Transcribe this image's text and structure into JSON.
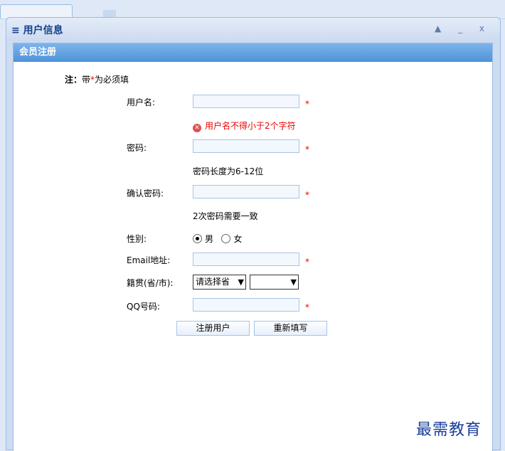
{
  "window": {
    "title": "用户信息",
    "tools": "▲ _ x"
  },
  "panel": {
    "title": "会员注册"
  },
  "note": {
    "prefix": "注：",
    "mid": "带",
    "star": "*",
    "suffix": "为必须填"
  },
  "form": {
    "username": {
      "label": "用户名:",
      "value": "",
      "required": "*",
      "error": "用户名不得小于2个字符"
    },
    "password": {
      "label": "密码:",
      "value": "",
      "required": "*",
      "hint": "密码长度为6-12位"
    },
    "confirm": {
      "label": "确认密码:",
      "value": "",
      "required": "*",
      "hint": "2次密码需要一致"
    },
    "gender": {
      "label": "性别:",
      "options": [
        "男",
        "女"
      ],
      "selected": "男"
    },
    "email": {
      "label": "Email地址:",
      "value": "",
      "required": "*"
    },
    "origin": {
      "label": "籍贯(省/市):",
      "province": "请选择省",
      "city": ""
    },
    "qq": {
      "label": "QQ号码:",
      "value": "",
      "required": "*"
    }
  },
  "buttons": {
    "submit": "注册用户",
    "reset": "重新填写"
  },
  "watermark": "最需教育",
  "colors": {
    "header": "#15428b",
    "panel_header": "#4e93da",
    "required": "#e00000",
    "input_bg": "#f3f8fe"
  }
}
